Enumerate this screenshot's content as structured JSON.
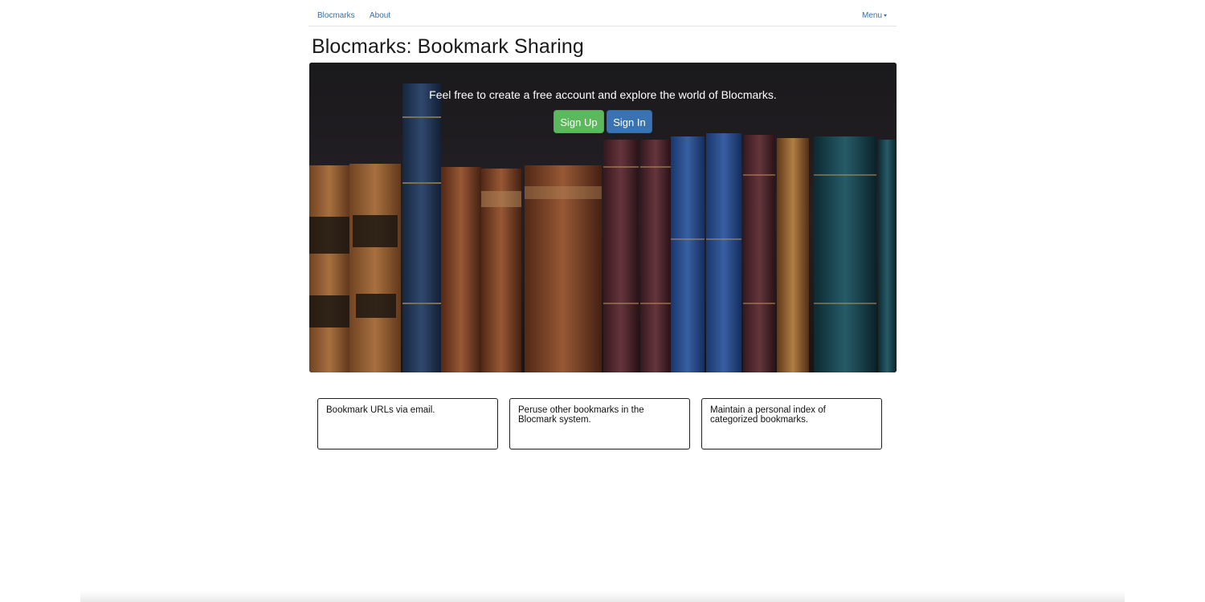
{
  "nav": {
    "brand": "Blocmarks",
    "about": "About",
    "menu": "Menu"
  },
  "page": {
    "title": "Blocmarks: Bookmark Sharing"
  },
  "hero": {
    "tagline": "Feel free to create a free account and explore the world of Blocmarks.",
    "signup_label": "Sign Up",
    "signin_label": "Sign In"
  },
  "features": [
    "Bookmark URLs via email.",
    "Peruse other bookmarks in the Blocmark system.",
    "Maintain a personal index of categorized bookmarks."
  ],
  "colors": {
    "link": "#3a6ea5",
    "signup": "#5cb85c",
    "signin": "#3a73b4"
  }
}
